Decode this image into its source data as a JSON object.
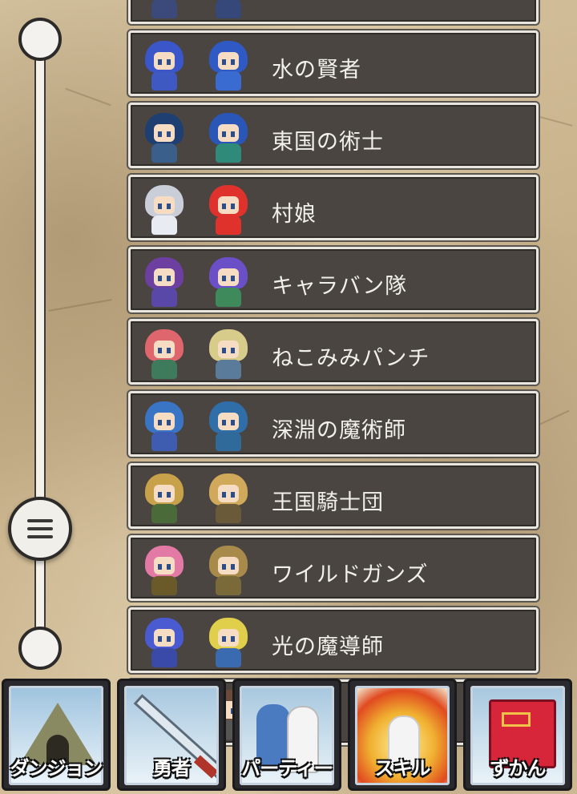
{
  "slider": {
    "position": 0.82
  },
  "list": {
    "items": [
      {
        "label": "",
        "hair_a": "#3a4f9a",
        "hair_b": "#2f3f88",
        "body_a": "#3b4a7a",
        "body_b": "#36477a"
      },
      {
        "label": "水の賢者",
        "hair_a": "#3a56c9",
        "hair_b": "#2f59c4",
        "body_a": "#3e5ac2",
        "body_b": "#3a6bd0"
      },
      {
        "label": "東国の術士",
        "hair_a": "#1f3f73",
        "hair_b": "#2a56b8",
        "body_a": "#3a5f8a",
        "body_b": "#2f8a7a"
      },
      {
        "label": "村娘",
        "hair_a": "#c9ced8",
        "hair_b": "#e0322d",
        "body_a": "#e8ecf2",
        "body_b": "#e0322d"
      },
      {
        "label": "キャラバン隊",
        "hair_a": "#6c3fa0",
        "hair_b": "#6a4fc6",
        "body_a": "#5a48a8",
        "body_b": "#3f8a5a"
      },
      {
        "label": "ねこみみパンチ",
        "hair_a": "#e0666e",
        "hair_b": "#d8cc8a",
        "body_a": "#3e7a5c",
        "body_b": "#5a7c9a"
      },
      {
        "label": "深淵の魔術師",
        "hair_a": "#3a74c4",
        "hair_b": "#2f6ea8",
        "body_a": "#3f5db0",
        "body_b": "#2f6a9a"
      },
      {
        "label": "王国騎士団",
        "hair_a": "#c8a24a",
        "hair_b": "#d0aa5a",
        "body_a": "#4a6a3a",
        "body_b": "#6a5a3a"
      },
      {
        "label": "ワイルドガンズ",
        "hair_a": "#e37aa6",
        "hair_b": "#a88a4a",
        "body_a": "#6a5a2a",
        "body_b": "#7a6a3a"
      },
      {
        "label": "光の魔導師",
        "hair_a": "#4a5ad0",
        "hair_b": "#e0cf4a",
        "body_a": "#3a4aa8",
        "body_b": "#3a6ab0"
      },
      {
        "label": "",
        "hair_a": "#555555",
        "hair_b": "#6a4a3a",
        "body_a": "#444444",
        "body_b": "#555555"
      }
    ]
  },
  "nav": {
    "dungeon": "ダンジョン",
    "hero": "勇者",
    "party": "パーティー",
    "skill": "スキル",
    "zukan": "ずかん"
  },
  "colors": {
    "row_bg": "#4a4541",
    "row_border": "#e9e6df",
    "label_text": "#f2f0ea"
  }
}
